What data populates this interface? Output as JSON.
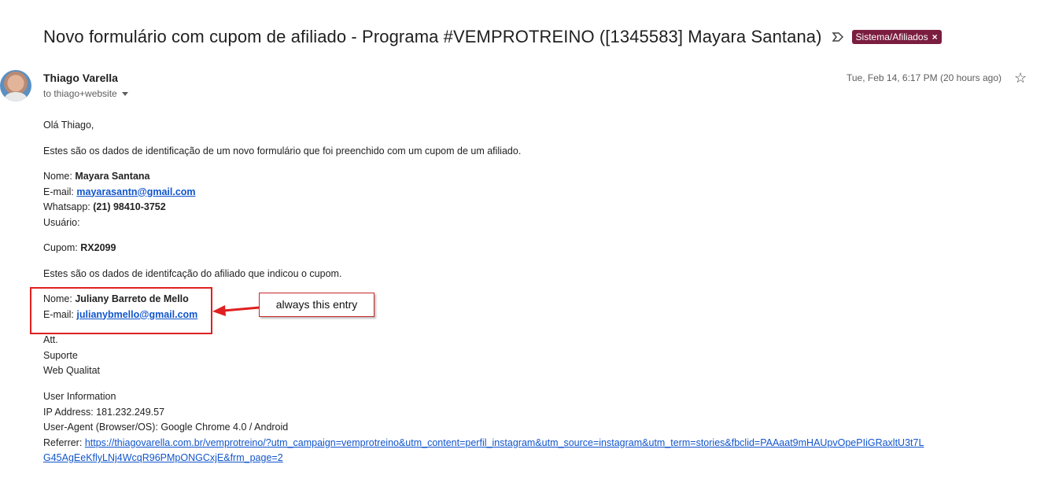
{
  "subject": "Novo formulário com cupom de afiliado - Programa #VEMPROTREINO ([1345583] Mayara Santana)",
  "label": {
    "text": "Sistema/Afiliados",
    "remove": "×",
    "color": "#7b1d3f"
  },
  "sender": {
    "name": "Thiago Varella",
    "to": "to thiago+website"
  },
  "date": "Tue, Feb 14, 6:17 PM (20 hours ago)",
  "icons": {
    "star": "star-outline-icon",
    "importance": "importance-marker-icon",
    "caret": "chevron-down-icon"
  },
  "body": {
    "greeting": "Olá Thiago,",
    "intro": "Estes são os dados de identificação de um novo formulário que foi preenchido com um cupom de um afiliado.",
    "nome_label": "Nome:",
    "nome_value": "Mayara Santana",
    "email_label": "E-mail:",
    "email_value": "mayarasantn@gmail.com",
    "whatsapp_label": "Whatsapp:",
    "whatsapp_value": "(21) 98410-3752",
    "usuario_label": "Usuário:",
    "cupom_label": "Cupom:",
    "cupom_value": "RX2099",
    "affiliate_intro": "Estes são os dados de identifcação do afiliado que indicou o cupom.",
    "aff_nome_label": "Nome:",
    "aff_nome_value": "Juliany Barreto de Mello",
    "aff_email_label": "E-mail:",
    "aff_email_value": "julianybmello@gmail.com",
    "sign_att": "Att.",
    "sign_suporte": "Suporte",
    "sign_company": "Web Qualitat",
    "ui_title": "User Information",
    "ip": "IP Address: 181.232.249.57",
    "ua": "User-Agent (Browser/OS): Google Chrome 4.0 / Android",
    "referrer_label": "Referrer:",
    "referrer_line1": "https://thiagovarella.com.br/vemprotreino/?utm_campaign=vemprotreino&utm_content=perfil_instagram&utm_source=instagram&utm_term=stories&fbclid=PAAaat9mHAUpvOpePIiGRaxltU3t7L",
    "referrer_line2": "G45AgEeKflyLNj4WcqR96PMpONGCxjE&frm_page=2"
  },
  "annotation": {
    "text": "always this entry",
    "color": "#e02020"
  }
}
